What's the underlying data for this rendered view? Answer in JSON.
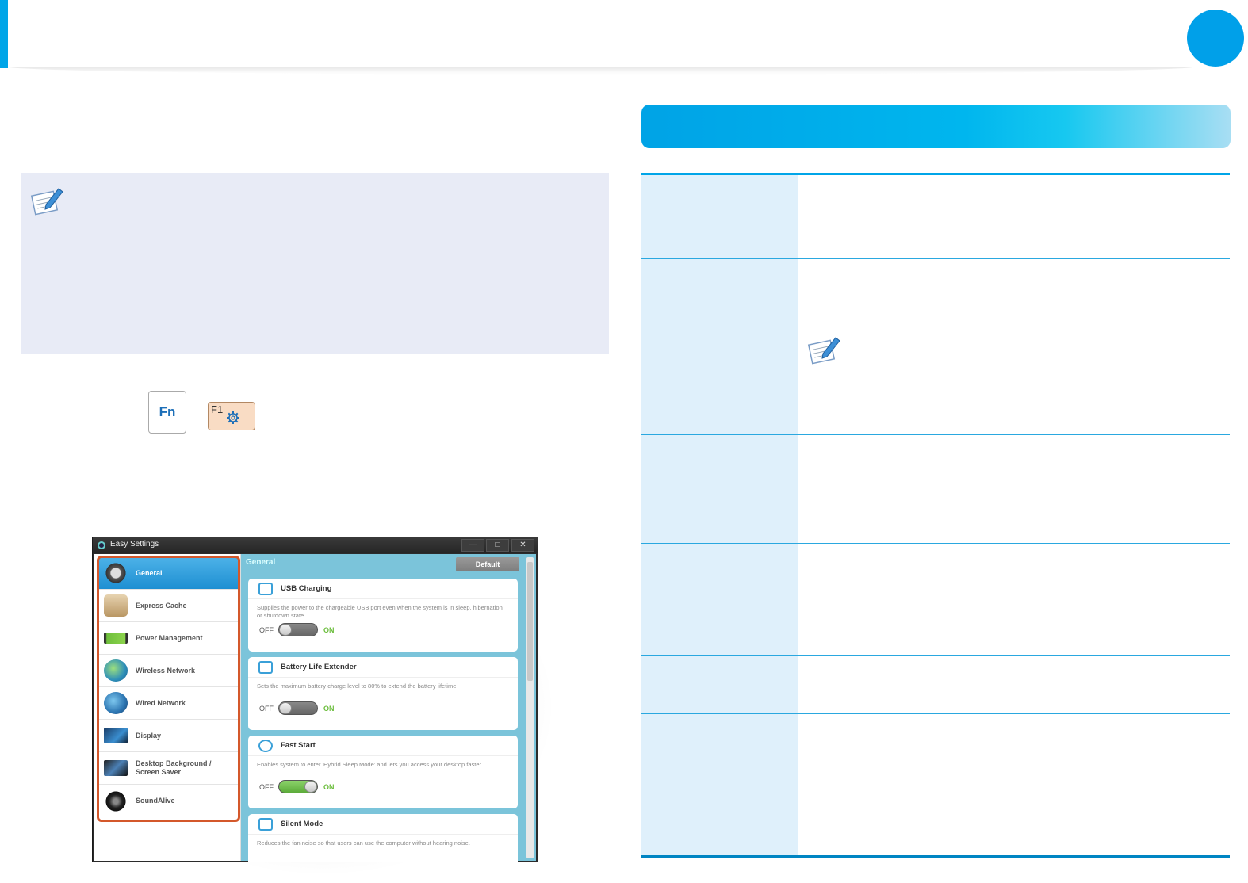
{
  "colors": {
    "accent": "#00a5e8",
    "note_bg": "#e8ebf6",
    "table_label_bg": "#dff0fb",
    "highlight_border": "#d4582b"
  },
  "keys": {
    "fn_label": "Fn",
    "f1_label": "F1",
    "f1_icon": "gear-icon"
  },
  "window": {
    "title": "Easy Settings",
    "controls": {
      "minimize": "—",
      "maximize": "□",
      "close": "✕"
    },
    "sidebar": [
      {
        "label": "General",
        "icon": "gear-icon",
        "active": true
      },
      {
        "label": "Express Cache",
        "icon": "cache-box-icon"
      },
      {
        "label": "Power Management",
        "icon": "battery-icon"
      },
      {
        "label": "Wireless Network",
        "icon": "wireless-globe-icon"
      },
      {
        "label": "Wired Network",
        "icon": "wired-globe-icon"
      },
      {
        "label": "Display",
        "icon": "monitor-icon"
      },
      {
        "label": "Desktop Background / Screen Saver",
        "icon": "desktop-background-icon"
      },
      {
        "label": "SoundAlive",
        "icon": "speaker-icon"
      }
    ],
    "main": {
      "heading": "General",
      "default_button": "Default",
      "cards": [
        {
          "title": "USB Charging",
          "icon": "usb-icon",
          "desc": "Supplies the power to the chargeable USB port even when the system is in sleep, hibernation or shutdown state.",
          "off": "OFF",
          "on": "ON",
          "state": "off"
        },
        {
          "title": "Battery Life Extender",
          "icon": "battery-icon",
          "desc": "Sets the maximum battery charge level to 80% to extend the battery lifetime.",
          "off": "OFF",
          "on": "ON",
          "state": "off"
        },
        {
          "title": "Fast Start",
          "icon": "fast-start-icon",
          "desc": "Enables system to enter 'Hybrid Sleep Mode' and lets you access your desktop faster.",
          "off": "OFF",
          "on": "ON",
          "state": "on"
        },
        {
          "title": "Silent Mode",
          "icon": "fan-icon",
          "desc": "Reduces the fan noise so that users can use the computer without hearing noise."
        }
      ]
    }
  }
}
